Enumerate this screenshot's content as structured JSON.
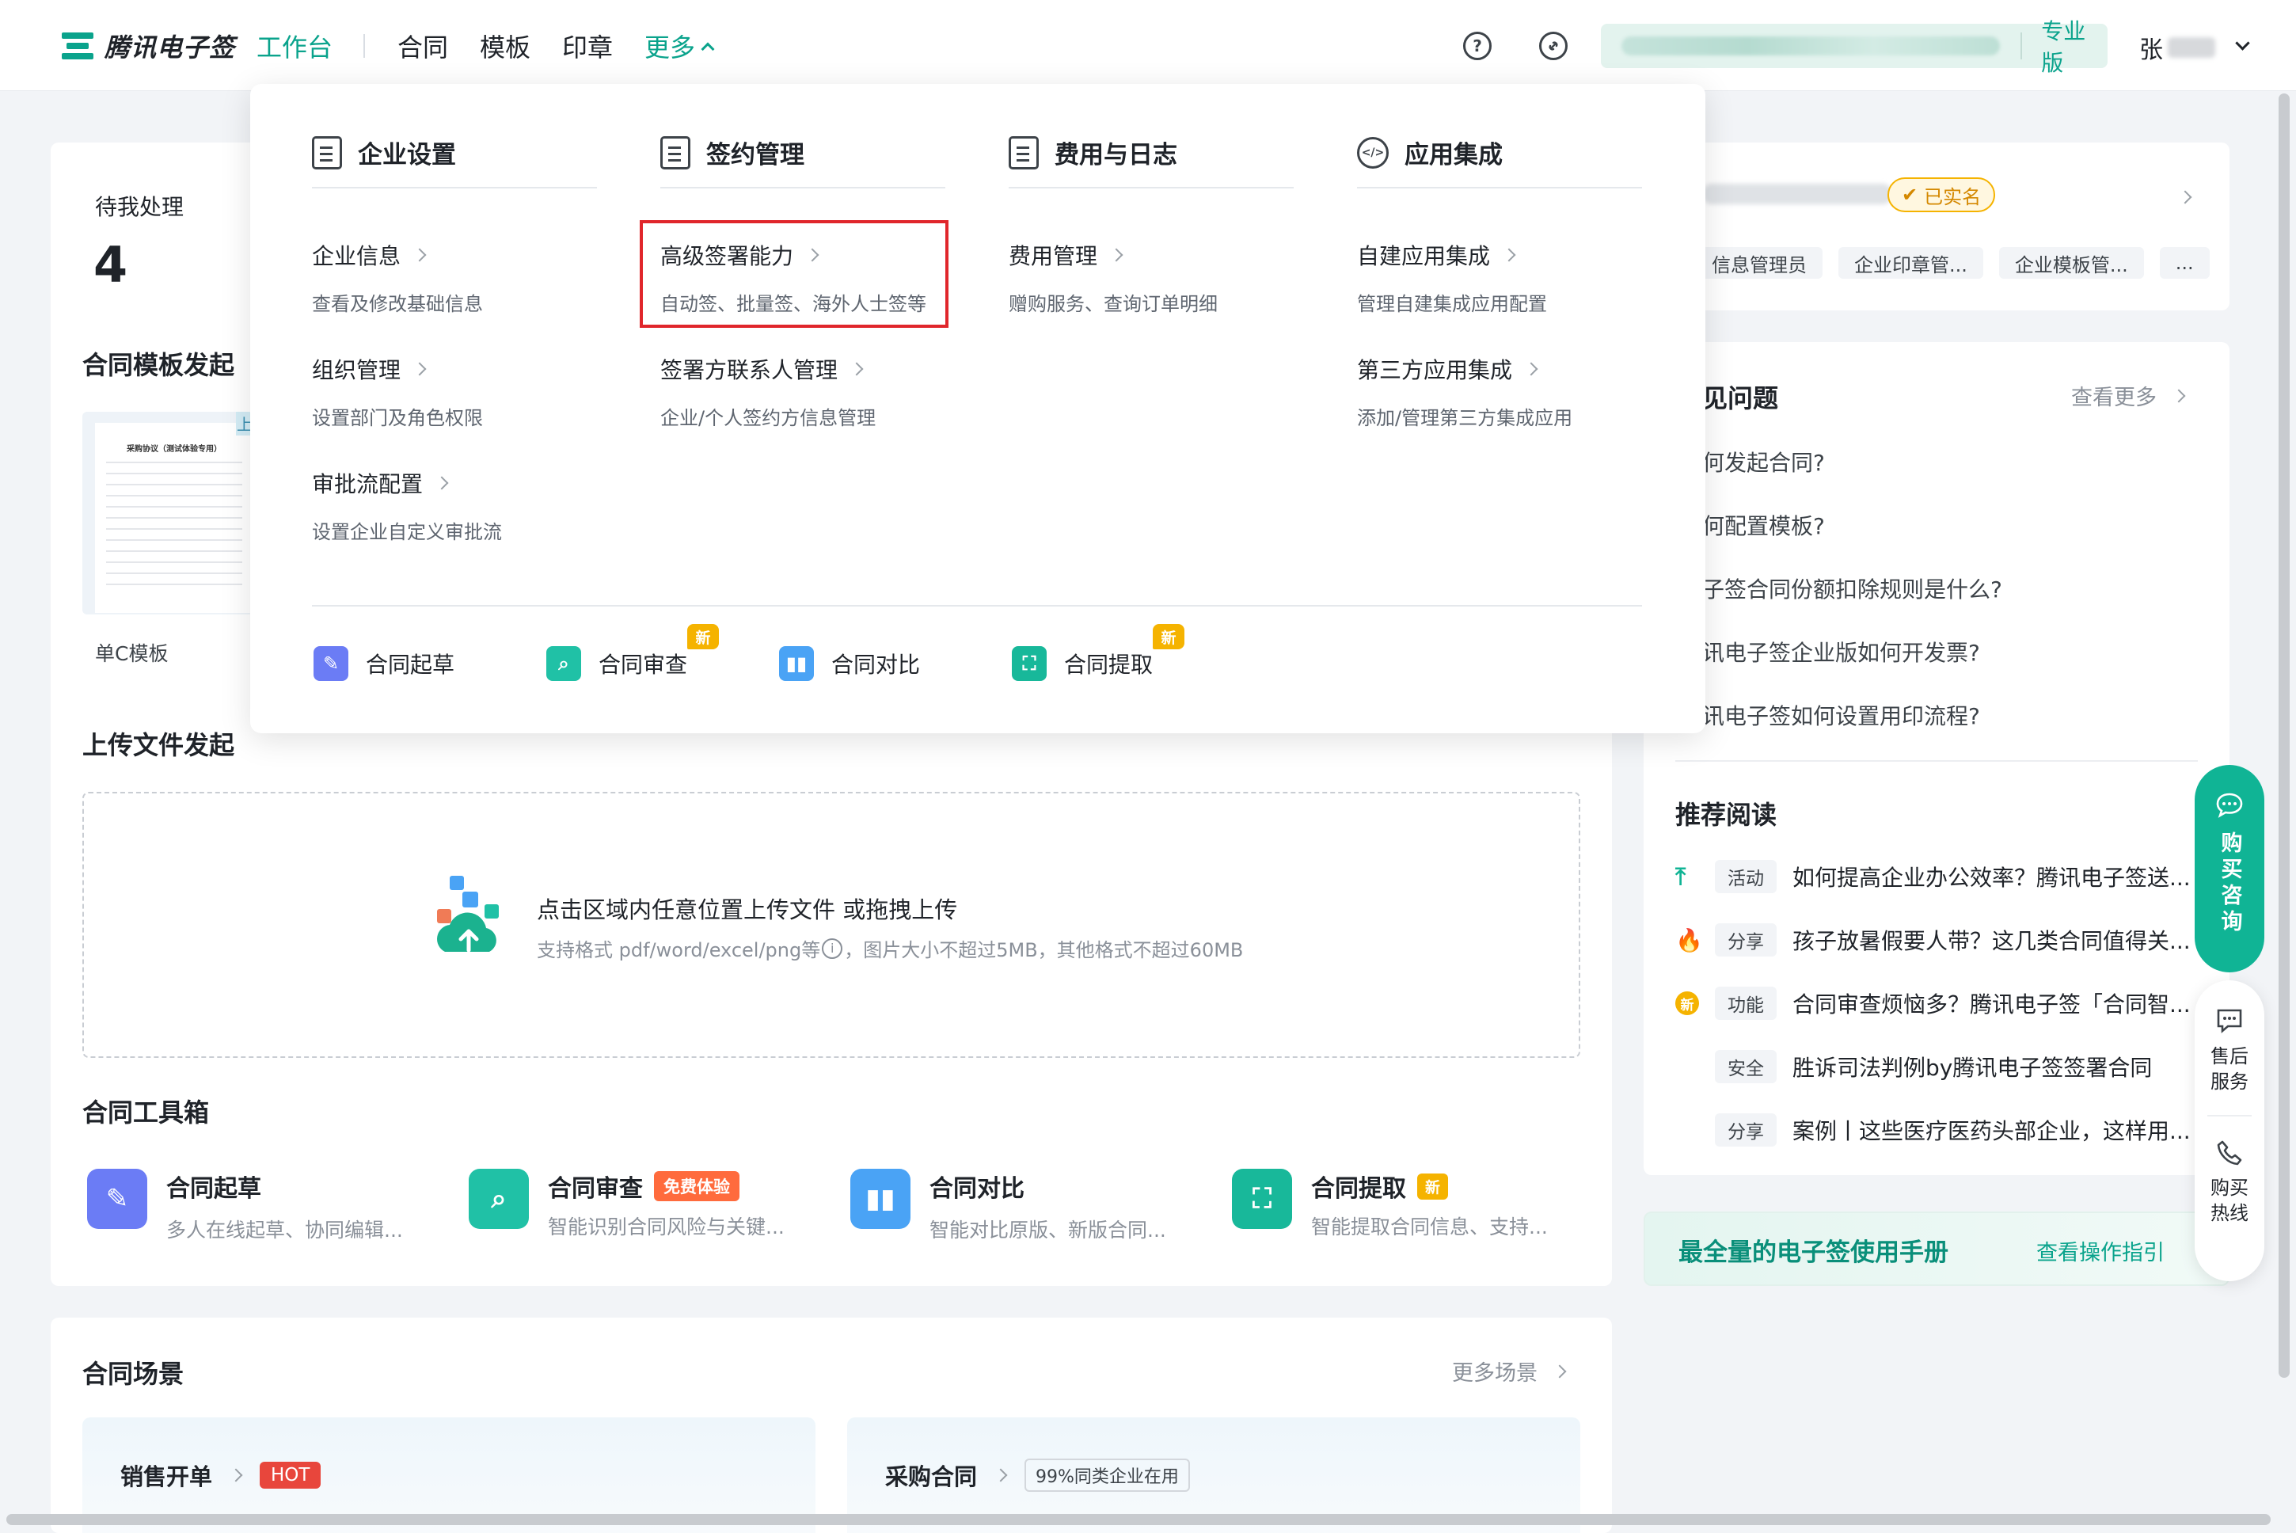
{
  "brand": {
    "name": "腾讯电子签"
  },
  "nav": {
    "items": [
      {
        "label": "工作台",
        "active": true
      },
      {
        "label": "合同"
      },
      {
        "label": "模板"
      },
      {
        "label": "印章"
      },
      {
        "label": "更多",
        "open": true
      }
    ]
  },
  "header": {
    "help_icon": "question-circle-icon",
    "link_icon": "link-circle-icon",
    "plan": "专业版",
    "user_name": "张"
  },
  "pending": {
    "label": "待我处理",
    "count": "4"
  },
  "template_section": {
    "title": "合同模板发起",
    "doc_title": "采购协议（测试体验专用）",
    "card_label": "单C模板",
    "corner_tag": "上"
  },
  "dropdown": {
    "columns": [
      {
        "heading": "企业设置",
        "icon": "document-icon",
        "items": [
          {
            "title": "企业信息",
            "desc": "查看及修改基础信息"
          },
          {
            "title": "组织管理",
            "desc": "设置部门及角色权限"
          },
          {
            "title": "审批流配置",
            "desc": "设置企业自定义审批流"
          }
        ]
      },
      {
        "heading": "签约管理",
        "icon": "sign-doc-icon",
        "items": [
          {
            "title": "高级签署能力",
            "desc": "自动签、批量签、海外人士签等"
          },
          {
            "title": "签署方联系人管理",
            "desc": "企业/个人签约方信息管理"
          }
        ]
      },
      {
        "heading": "费用与日志",
        "icon": "cart-doc-icon",
        "items": [
          {
            "title": "费用管理",
            "desc": "赠购服务、查询订单明细"
          }
        ]
      },
      {
        "heading": "应用集成",
        "icon": "code-gear-icon",
        "items": [
          {
            "title": "自建应用集成",
            "desc": "管理自建集成应用配置"
          },
          {
            "title": "第三方应用集成",
            "desc": "添加/管理第三方集成应用"
          }
        ]
      }
    ],
    "tools": [
      {
        "label": "合同起草",
        "icon": "pen-icon",
        "color": "#6b7cf5",
        "is_new": false
      },
      {
        "label": "合同审查",
        "icon": "magnifier-icon",
        "color": "#20c1a6",
        "is_new": true
      },
      {
        "label": "合同对比",
        "icon": "compare-icon",
        "color": "#4aa3f5",
        "is_new": false
      },
      {
        "label": "合同提取",
        "icon": "scan-icon",
        "color": "#18b89a",
        "is_new": true
      }
    ],
    "new_badge": "新"
  },
  "upload": {
    "section_title": "上传文件发起",
    "main_text": "点击区域内任意位置上传文件 或拖拽上传",
    "hint_prefix": "支持格式 pdf/word/excel/png等",
    "hint_suffix": "，图片大小不超过5MB，其他格式不超过60MB"
  },
  "toolbox": {
    "title": "合同工具箱",
    "items": [
      {
        "title": "合同起草",
        "desc": "多人在线起草、协同编辑...",
        "color": "#6b7cf5",
        "icon": "pen-icon",
        "badge": ""
      },
      {
        "title": "合同审查",
        "desc": "智能识别合同风险与关键...",
        "color": "#20c1a6",
        "icon": "magnifier-icon",
        "badge": "免费体验"
      },
      {
        "title": "合同对比",
        "desc": "智能对比原版、新版合同...",
        "color": "#4aa3f5",
        "icon": "compare-icon",
        "badge": ""
      },
      {
        "title": "合同提取",
        "desc": "智能提取合同信息、支持...",
        "color": "#18b89a",
        "icon": "scan-icon",
        "badge": "新"
      }
    ]
  },
  "scenes": {
    "title": "合同场景",
    "more": "更多场景",
    "cards": [
      {
        "title": "销售开单",
        "badge": "HOT"
      },
      {
        "title": "采购合同",
        "badge": "99%同类企业在用"
      }
    ]
  },
  "account_card": {
    "verified": "已实名",
    "roles": [
      "信息管理员",
      "企业印章管...",
      "企业模板管...",
      "..."
    ]
  },
  "faq": {
    "title": "见问题",
    "more": "查看更多",
    "items": [
      "何发起合同?",
      "何配置模板?",
      "子签合同份额扣除规则是什么?",
      "讯电子签企业版如何开发票?",
      "讯电子签如何设置用印流程?"
    ]
  },
  "recommend": {
    "title": "推荐阅读",
    "items": [
      {
        "icon": "top-arrow-icon",
        "tag": "活动",
        "text": "如何提高企业办公效率？腾讯电子签送..."
      },
      {
        "icon": "fire-icon",
        "tag": "分享",
        "text": "孩子放暑假要人带？这几类合同值得关..."
      },
      {
        "icon": "new-circle-icon",
        "tag": "功能",
        "text": "合同审查烦恼多？腾讯电子签「合同智..."
      },
      {
        "icon": "",
        "tag": "安全",
        "text": "胜诉司法判例by腾讯电子签签署合同"
      },
      {
        "icon": "",
        "tag": "分享",
        "text": "案例丨这些医疗医药头部企业，这样用..."
      }
    ]
  },
  "manual": {
    "title": "最全量的电子签使用手册",
    "link": "查看操作指引"
  },
  "float_service": {
    "buy_consult": "购买咨询",
    "after_sales": "售后服务",
    "hotline": "购买热线"
  }
}
